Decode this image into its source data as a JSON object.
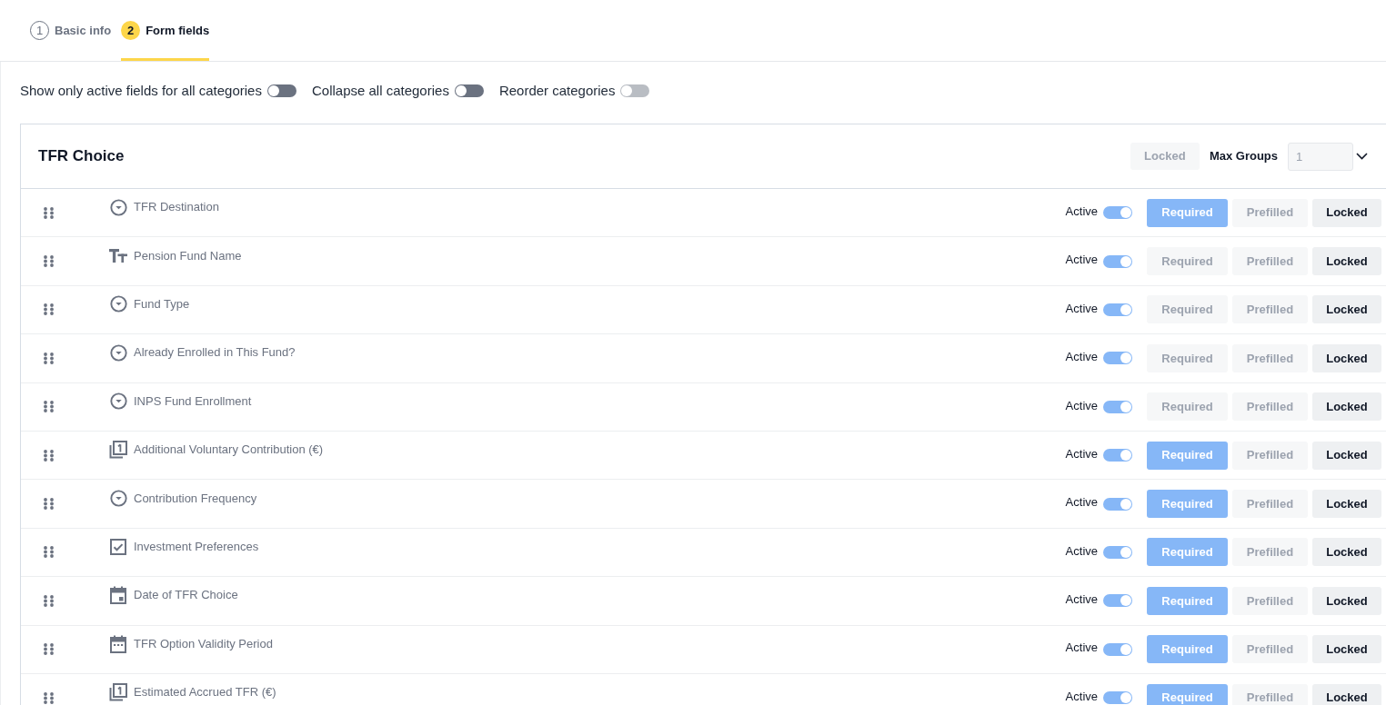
{
  "tabs": [
    {
      "number": "1",
      "label": "Basic info",
      "selected": false
    },
    {
      "number": "2",
      "label": "Form fields",
      "selected": true
    }
  ],
  "options": [
    {
      "label": "Show only active fields for all categories",
      "on": false,
      "disabled": false
    },
    {
      "label": "Collapse all categories",
      "on": false,
      "disabled": false
    },
    {
      "label": "Reorder categories",
      "on": false,
      "disabled": true
    }
  ],
  "category": {
    "title": "TFR Choice",
    "locked_button": {
      "label": "Locked",
      "selected": false
    },
    "max_groups": {
      "label": "Max Groups",
      "value": "1",
      "disabled": true
    },
    "fields": [
      {
        "kind": "dropdown",
        "label": "TFR Destination",
        "active_label": "Active",
        "active": true,
        "buttons": [
          {
            "kind": "required",
            "label": "Required",
            "selected": true
          },
          {
            "kind": "prefilled",
            "label": "Prefilled",
            "selected": false
          },
          {
            "kind": "locked",
            "label": "Locked",
            "selected": true
          }
        ]
      },
      {
        "kind": "text",
        "label": "Pension Fund Name",
        "active_label": "Active",
        "active": true,
        "buttons": [
          {
            "kind": "required",
            "label": "Required",
            "selected": false
          },
          {
            "kind": "prefilled",
            "label": "Prefilled",
            "selected": false
          },
          {
            "kind": "locked",
            "label": "Locked",
            "selected": true
          }
        ]
      },
      {
        "kind": "dropdown",
        "label": "Fund Type",
        "active_label": "Active",
        "active": true,
        "buttons": [
          {
            "kind": "required",
            "label": "Required",
            "selected": false
          },
          {
            "kind": "prefilled",
            "label": "Prefilled",
            "selected": false
          },
          {
            "kind": "locked",
            "label": "Locked",
            "selected": true
          }
        ]
      },
      {
        "kind": "dropdown",
        "label": "Already Enrolled in This Fund?",
        "active_label": "Active",
        "active": true,
        "buttons": [
          {
            "kind": "required",
            "label": "Required",
            "selected": false
          },
          {
            "kind": "prefilled",
            "label": "Prefilled",
            "selected": false
          },
          {
            "kind": "locked",
            "label": "Locked",
            "selected": true
          }
        ]
      },
      {
        "kind": "dropdown",
        "label": "INPS Fund Enrollment",
        "active_label": "Active",
        "active": true,
        "buttons": [
          {
            "kind": "required",
            "label": "Required",
            "selected": false
          },
          {
            "kind": "prefilled",
            "label": "Prefilled",
            "selected": false
          },
          {
            "kind": "locked",
            "label": "Locked",
            "selected": true
          }
        ]
      },
      {
        "kind": "number",
        "label": "Additional Voluntary Contribution (€)",
        "active_label": "Active",
        "active": true,
        "buttons": [
          {
            "kind": "required",
            "label": "Required",
            "selected": true
          },
          {
            "kind": "prefilled",
            "label": "Prefilled",
            "selected": false
          },
          {
            "kind": "locked",
            "label": "Locked",
            "selected": true
          }
        ]
      },
      {
        "kind": "dropdown",
        "label": "Contribution Frequency",
        "active_label": "Active",
        "active": true,
        "buttons": [
          {
            "kind": "required",
            "label": "Required",
            "selected": true
          },
          {
            "kind": "prefilled",
            "label": "Prefilled",
            "selected": false
          },
          {
            "kind": "locked",
            "label": "Locked",
            "selected": true
          }
        ]
      },
      {
        "kind": "checkbox",
        "label": "Investment Preferences",
        "active_label": "Active",
        "active": true,
        "buttons": [
          {
            "kind": "required",
            "label": "Required",
            "selected": true
          },
          {
            "kind": "prefilled",
            "label": "Prefilled",
            "selected": false
          },
          {
            "kind": "locked",
            "label": "Locked",
            "selected": true
          }
        ]
      },
      {
        "kind": "date",
        "label": "Date of TFR Choice",
        "active_label": "Active",
        "active": true,
        "buttons": [
          {
            "kind": "required",
            "label": "Required",
            "selected": true
          },
          {
            "kind": "prefilled",
            "label": "Prefilled",
            "selected": false
          },
          {
            "kind": "locked",
            "label": "Locked",
            "selected": true
          }
        ]
      },
      {
        "kind": "period",
        "label": "TFR Option Validity Period",
        "active_label": "Active",
        "active": true,
        "buttons": [
          {
            "kind": "required",
            "label": "Required",
            "selected": true
          },
          {
            "kind": "prefilled",
            "label": "Prefilled",
            "selected": false
          },
          {
            "kind": "locked",
            "label": "Locked",
            "selected": true
          }
        ]
      },
      {
        "kind": "number",
        "label": "Estimated Accrued TFR (€)",
        "active_label": "Active",
        "active": true,
        "buttons": [
          {
            "kind": "required",
            "label": "Required",
            "selected": true
          },
          {
            "kind": "prefilled",
            "label": "Prefilled",
            "selected": false
          },
          {
            "kind": "locked",
            "label": "Locked",
            "selected": true
          }
        ]
      }
    ]
  }
}
